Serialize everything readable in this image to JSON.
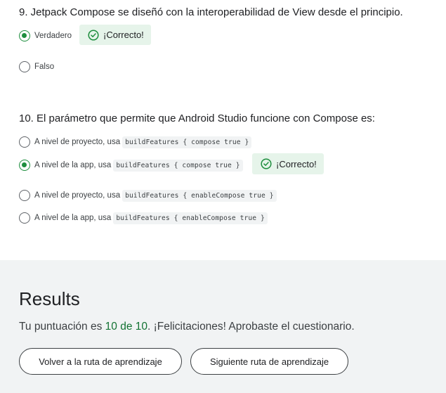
{
  "questions": [
    {
      "title": "9. Jetpack Compose se diseñó con la interoperabilidad de View desde el principio.",
      "options": [
        {
          "label": "Verdadero",
          "code": "",
          "selected": true
        },
        {
          "label": "Falso",
          "code": "",
          "selected": false
        }
      ],
      "feedback": "¡Correcto!"
    },
    {
      "title": "10. El parámetro que permite que Android Studio funcione con Compose es:",
      "options": [
        {
          "label": "A nivel de proyecto, usa",
          "code": "buildFeatures { compose true }",
          "selected": false
        },
        {
          "label": "A nivel de la app, usa",
          "code": "buildFeatures { compose true }",
          "selected": true
        },
        {
          "label": "A nivel de proyecto, usa",
          "code": "buildFeatures { enableCompose true }",
          "selected": false
        },
        {
          "label": "A nivel de la app, usa",
          "code": "buildFeatures { enableCompose true }",
          "selected": false
        }
      ],
      "feedback": "¡Correcto!"
    }
  ],
  "results": {
    "title": "Results",
    "score_prefix": "Tu puntuación es ",
    "score_value": "10 de 10",
    "score_suffix": ". ¡Felicitaciones! Aprobaste el cuestionario.",
    "back_button": "Volver a la ruta de aprendizaje",
    "next_button": "Siguiente ruta de aprendizaje"
  },
  "colors": {
    "accent_green": "#1e8e3e",
    "feedback_bg": "#e6f4ea",
    "results_bg": "#f1f3f4",
    "score_green": "#137333"
  },
  "icons": {
    "selected_radio": "radio-checked-icon",
    "unselected_radio": "radio-unchecked-icon",
    "feedback": "check-circle-icon"
  }
}
